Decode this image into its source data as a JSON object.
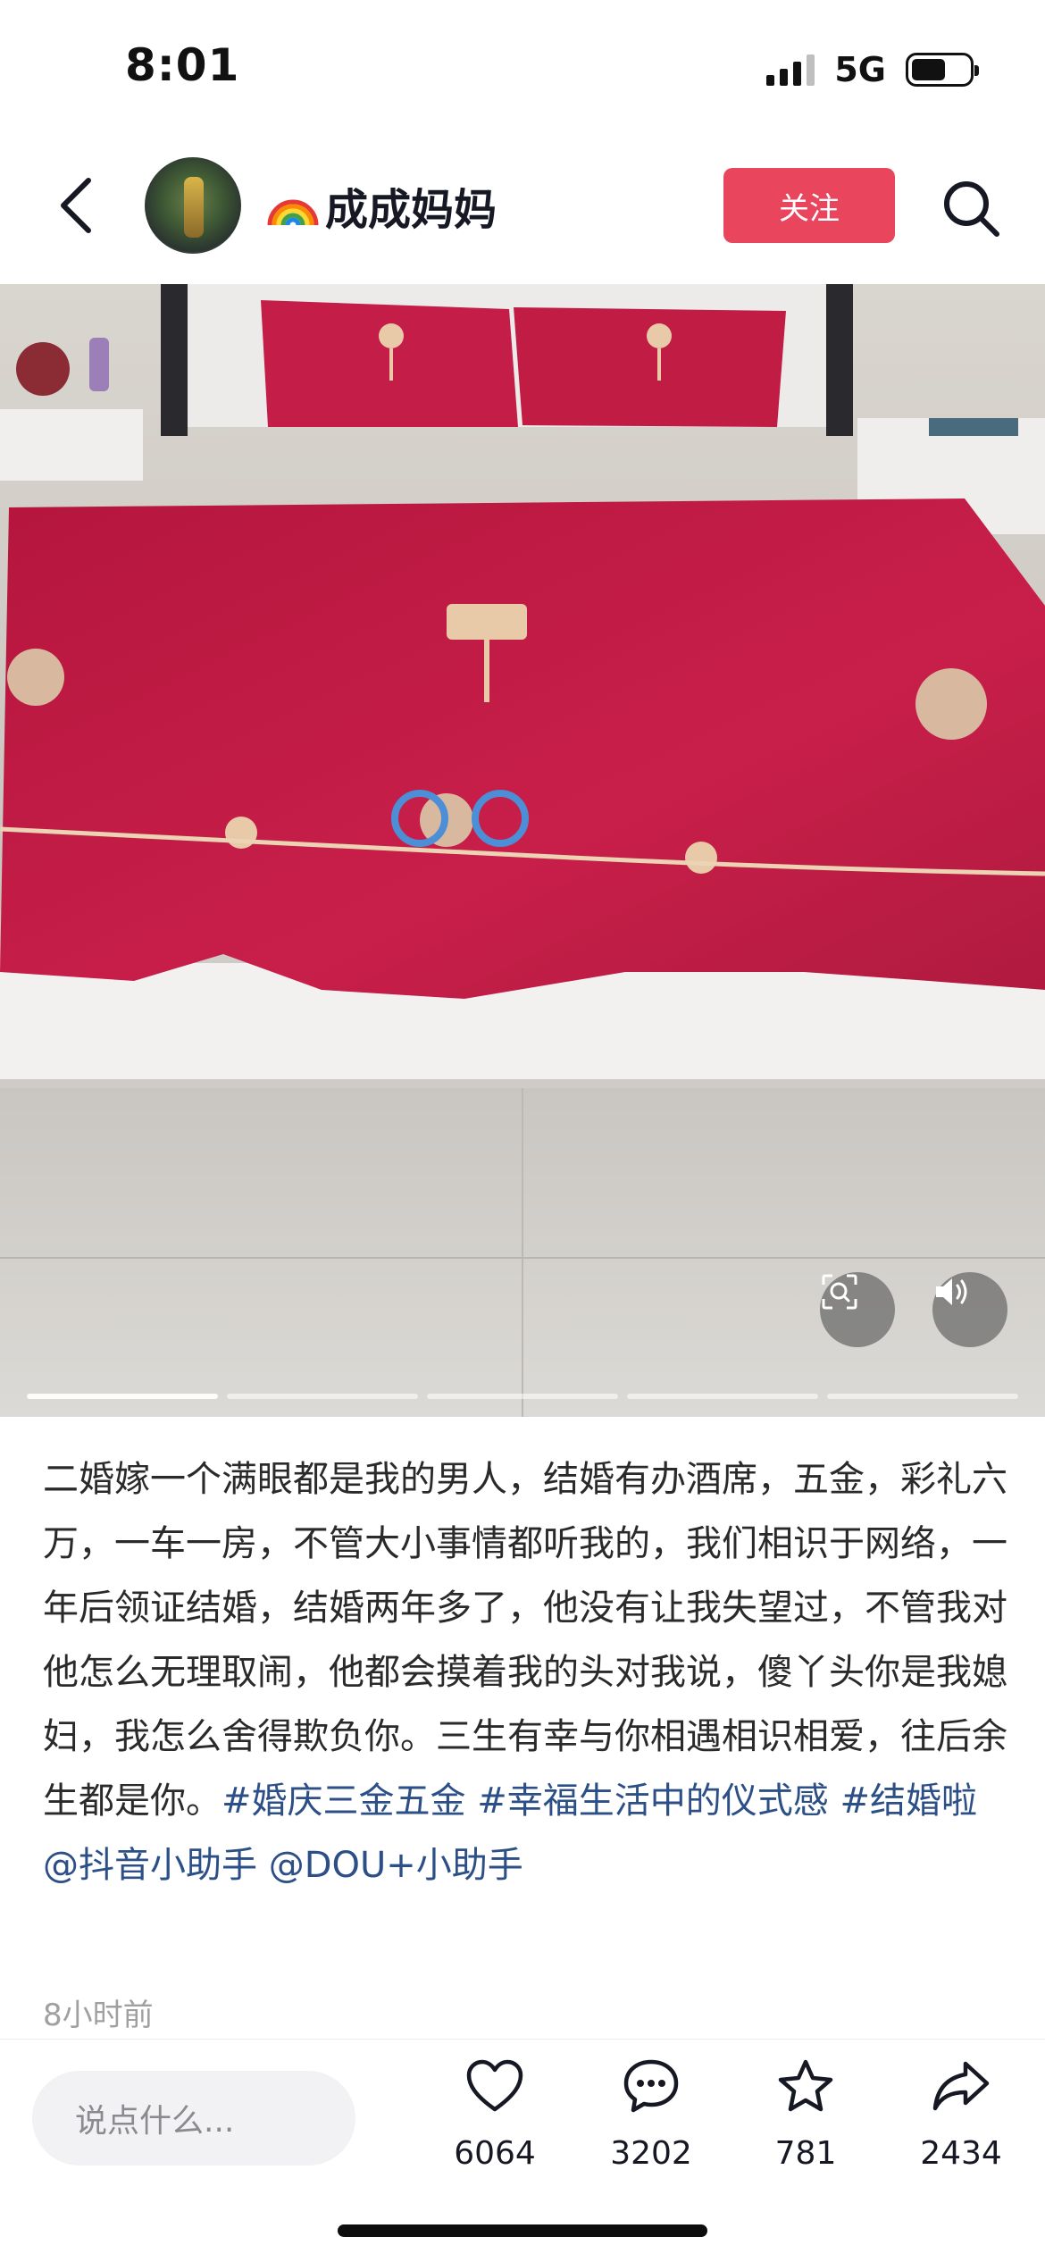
{
  "status_bar": {
    "time": "8:01",
    "network": "5G",
    "battery_level": 0.6
  },
  "header": {
    "username": "成成妈妈",
    "username_prefix_icon": "rainbow-icon",
    "follow_label": "关注",
    "icons": [
      "chevron-left-icon",
      "avatar",
      "search-icon"
    ]
  },
  "photo": {
    "carousel_segments": 5,
    "active_segment": 1,
    "icons": [
      "visual-search-icon",
      "speaker-icon"
    ]
  },
  "caption": {
    "text": "二婚嫁一个满眼都是我的男人，结婚有办酒席，五金，彩礼六万，一车一房，不管大小事情都听我的，我们相识于网络，一年后领证结婚，结婚两年多了，他没有让我失望过，不管我对他怎么无理取闹，他都会摸着我的头对我说，傻丫头你是我媳妇，我怎么舍得欺负你。三生有幸与你相遇相识相爱，往后余生都是你。",
    "tags": [
      "#婚庆三金五金",
      "#幸福生活中的仪式感",
      "#结婚啦",
      "@抖音小助手",
      "@DOU+小助手"
    ],
    "time_ago": "8小时前"
  },
  "bottom_bar": {
    "comment_placeholder": "说点什么...",
    "actions": [
      {
        "name": "like",
        "icon": "heart-icon",
        "count": "6064"
      },
      {
        "name": "comment",
        "icon": "comment-icon",
        "count": "3202"
      },
      {
        "name": "favorite",
        "icon": "star-icon",
        "count": "781"
      },
      {
        "name": "share",
        "icon": "share-icon",
        "count": "2434"
      }
    ]
  },
  "colors": {
    "accent": "#e9455d",
    "hashtag": "#2b4f86",
    "bedding": "#c01e46"
  }
}
